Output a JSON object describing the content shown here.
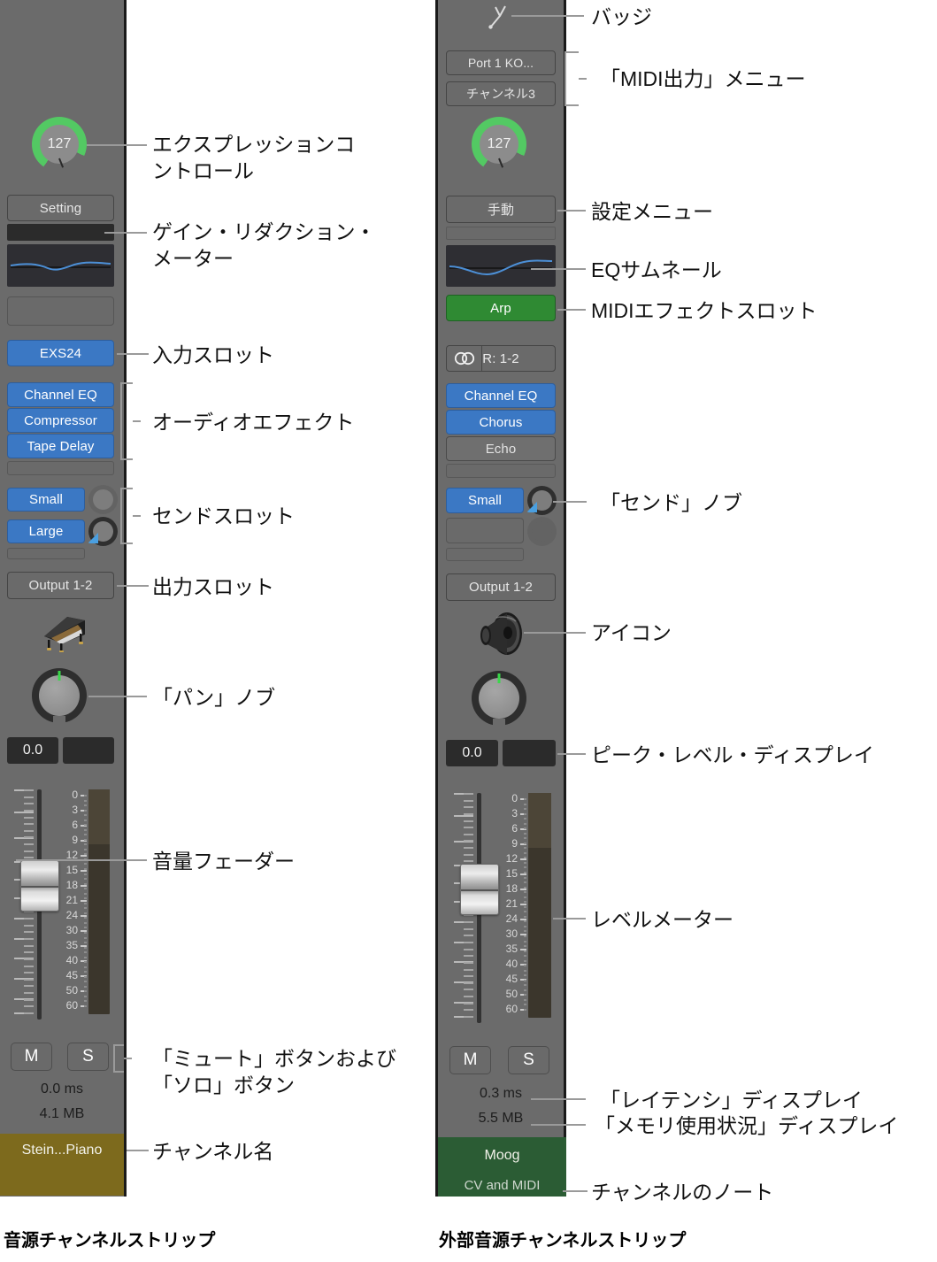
{
  "title": "Logic Pro channel strip callout diagram",
  "captions": {
    "left": "音源チャンネルストリップ",
    "right": "外部音源チャンネルストリップ"
  },
  "colors": {
    "strip_bg": "#6b6b6b",
    "slot_blue": "#3b78c4",
    "slot_green": "#2f8a33",
    "expression_green": "#53c963",
    "name_olive": "#7d6a1d",
    "name_green": "#2b5c34",
    "leader_grey": "#9a9a9a",
    "meter_dark": "#3b362c"
  },
  "left_strip": {
    "name": "音源チャンネルストリップ",
    "expression": {
      "value": "127",
      "icon": "expression-knob-icon"
    },
    "setting_menu": "Setting",
    "gain_reduction_meter": "",
    "eq_thumbnail": "eq-curve-icon",
    "empty_slot": "",
    "input_slot": "EXS24",
    "audio_effects": [
      "Channel EQ",
      "Compressor",
      "Tape Delay"
    ],
    "audio_effect_empty": "",
    "sends": [
      {
        "label": "Small",
        "knob": "send-knob-icon"
      },
      {
        "label": "Large",
        "knob": "send-knob-icon"
      }
    ],
    "send_empty": "",
    "output_slot": "Output 1-2",
    "icon": "grand-piano-icon",
    "pan_knob": "pan-knob-icon",
    "volume_value": "0.0",
    "peak_value": "",
    "scale_ticks": [
      "0",
      "3",
      "6",
      "9",
      "12",
      "15",
      "18",
      "21",
      "24",
      "30",
      "35",
      "40",
      "45",
      "50",
      "60"
    ],
    "mute_button": "M",
    "solo_button": "S",
    "latency": "0.0 ms",
    "memory": "4.1 MB",
    "channel_name": "Stein...Piano",
    "channel_note": ""
  },
  "right_strip": {
    "name": "外部音源チャンネルストリップ",
    "badge": "tuning-fork-badge-icon",
    "midi_output_menu": [
      "Port 1 KO...",
      "チャンネル3"
    ],
    "expression": {
      "value": "127",
      "icon": "expression-knob-icon"
    },
    "setting_menu": "手動",
    "gain_reduction_meter": "",
    "eq_thumbnail": "eq-curve-icon",
    "midi_effect_slot": "Arp",
    "input_format": {
      "icon": "stereo-icon",
      "label": "R: 1-2"
    },
    "audio_effects": [
      "Channel EQ",
      "Chorus",
      "Echo"
    ],
    "audio_effect_empty": "",
    "sends": [
      {
        "label": "Small",
        "knob": "send-knob-icon"
      },
      {
        "label": "",
        "knob": "send-knob-icon"
      }
    ],
    "send_empty": "",
    "output_slot": "Output 1-2",
    "icon": "speaker-icon",
    "pan_knob": "pan-knob-icon",
    "volume_value": "0.0",
    "peak_value": "",
    "scale_ticks": [
      "0",
      "3",
      "6",
      "9",
      "12",
      "15",
      "18",
      "21",
      "24",
      "30",
      "35",
      "40",
      "45",
      "50",
      "60"
    ],
    "mute_button": "M",
    "solo_button": "S",
    "latency": "0.3 ms",
    "memory": "5.5 MB",
    "channel_name": "Moog",
    "channel_note": "CV and MIDI"
  },
  "annotations": {
    "left": [
      {
        "id": "expression-control",
        "text": "エクスプレッションコ\nントロール"
      },
      {
        "id": "gain-reduction-meter",
        "text": "ゲイン・リダクション・\nメーター"
      },
      {
        "id": "input-slot",
        "text": "入力スロット"
      },
      {
        "id": "audio-effect",
        "text": "オーディオエフェクト"
      },
      {
        "id": "send-slot",
        "text": "センドスロット"
      },
      {
        "id": "output-slot",
        "text": "出力スロット"
      },
      {
        "id": "pan-knob",
        "text": "「パン」ノブ"
      },
      {
        "id": "volume-fader",
        "text": "音量フェーダー"
      },
      {
        "id": "mute-solo-buttons",
        "text": "「ミュート」ボタンおよび\n「ソロ」ボタン"
      },
      {
        "id": "channel-name",
        "text": "チャンネル名"
      }
    ],
    "right": [
      {
        "id": "badge",
        "text": "バッジ"
      },
      {
        "id": "midi-output-menu",
        "text": "「MIDI出力」メニュー"
      },
      {
        "id": "setting-menu",
        "text": "設定メニュー"
      },
      {
        "id": "eq-thumbnail",
        "text": "EQサムネール"
      },
      {
        "id": "midi-effect-slot",
        "text": "MIDIエフェクトスロット"
      },
      {
        "id": "send-knob",
        "text": "「センド」ノブ"
      },
      {
        "id": "icon",
        "text": "アイコン"
      },
      {
        "id": "peak-level-display",
        "text": "ピーク・レベル・ディスプレイ"
      },
      {
        "id": "level-meter",
        "text": "レベルメーター"
      },
      {
        "id": "latency-display",
        "text": "「レイテンシ」ディスプレイ"
      },
      {
        "id": "memory-usage-display",
        "text": "「メモリ使用状況」ディスプレイ"
      },
      {
        "id": "channel-note",
        "text": "チャンネルのノート"
      }
    ]
  }
}
